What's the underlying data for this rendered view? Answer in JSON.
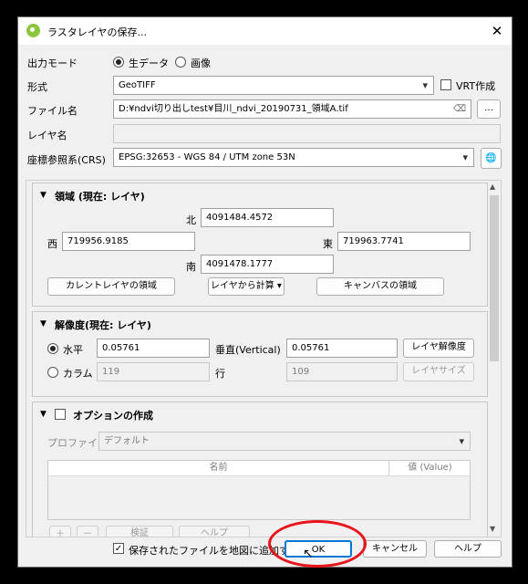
{
  "dialog": {
    "title": "ラスタレイヤの保存..."
  },
  "output_mode": {
    "label": "出力モード",
    "options": [
      "生データ",
      "画像"
    ],
    "selected": "生データ"
  },
  "format": {
    "label": "形式",
    "value": "GeoTIFF",
    "vrt_label": "VRT作成"
  },
  "filename": {
    "label": "ファイル名",
    "value": "D:¥ndvi切り出しtest¥目川_ndvi_20190731_領域A.tif",
    "browse": "..."
  },
  "layer_name": {
    "label": "レイヤ名",
    "value": ""
  },
  "crs": {
    "label": "座標参照系(CRS)",
    "value": "EPSG:32653 - WGS 84 / UTM zone 53N"
  },
  "extent": {
    "header": "領域 (現在: レイヤ)",
    "north_label": "北",
    "north": "4091484.4572",
    "west_label": "西",
    "west": "719956.9185",
    "east_label": "東",
    "east": "719963.7741",
    "south_label": "南",
    "south": "4091478.1777",
    "btn_current_layer": "カレントレイヤの領域",
    "btn_calc_from_layer": "レイヤから計算",
    "btn_canvas": "キャンバスの領域"
  },
  "resolution": {
    "header": "解像度(現在: レイヤ)",
    "horizontal_label": "水平",
    "horizontal": "0.05761",
    "vertical_label": "垂直(Vertical)",
    "vertical": "0.05761",
    "btn_layer_res": "レイヤ解像度",
    "columns_label": "カラム",
    "columns": "119",
    "rows_label": "行",
    "rows": "109",
    "btn_layer_size": "レイヤサイズ"
  },
  "creation_options": {
    "header": "オプションの作成",
    "profile_label": "プロファイル",
    "profile": "デフォルト",
    "col_name": "名前",
    "col_value": "値 (Value)",
    "btn_validate": "検証",
    "btn_help": "ヘルプ"
  },
  "footer": {
    "add_to_map": "保存されたファイルを地図に追加する",
    "ok": "OK",
    "cancel": "キャンセル",
    "help": "ヘルプ"
  },
  "colors": {
    "annotation_circle": "#e8141c",
    "qgis_icon": "#8cc63f"
  }
}
